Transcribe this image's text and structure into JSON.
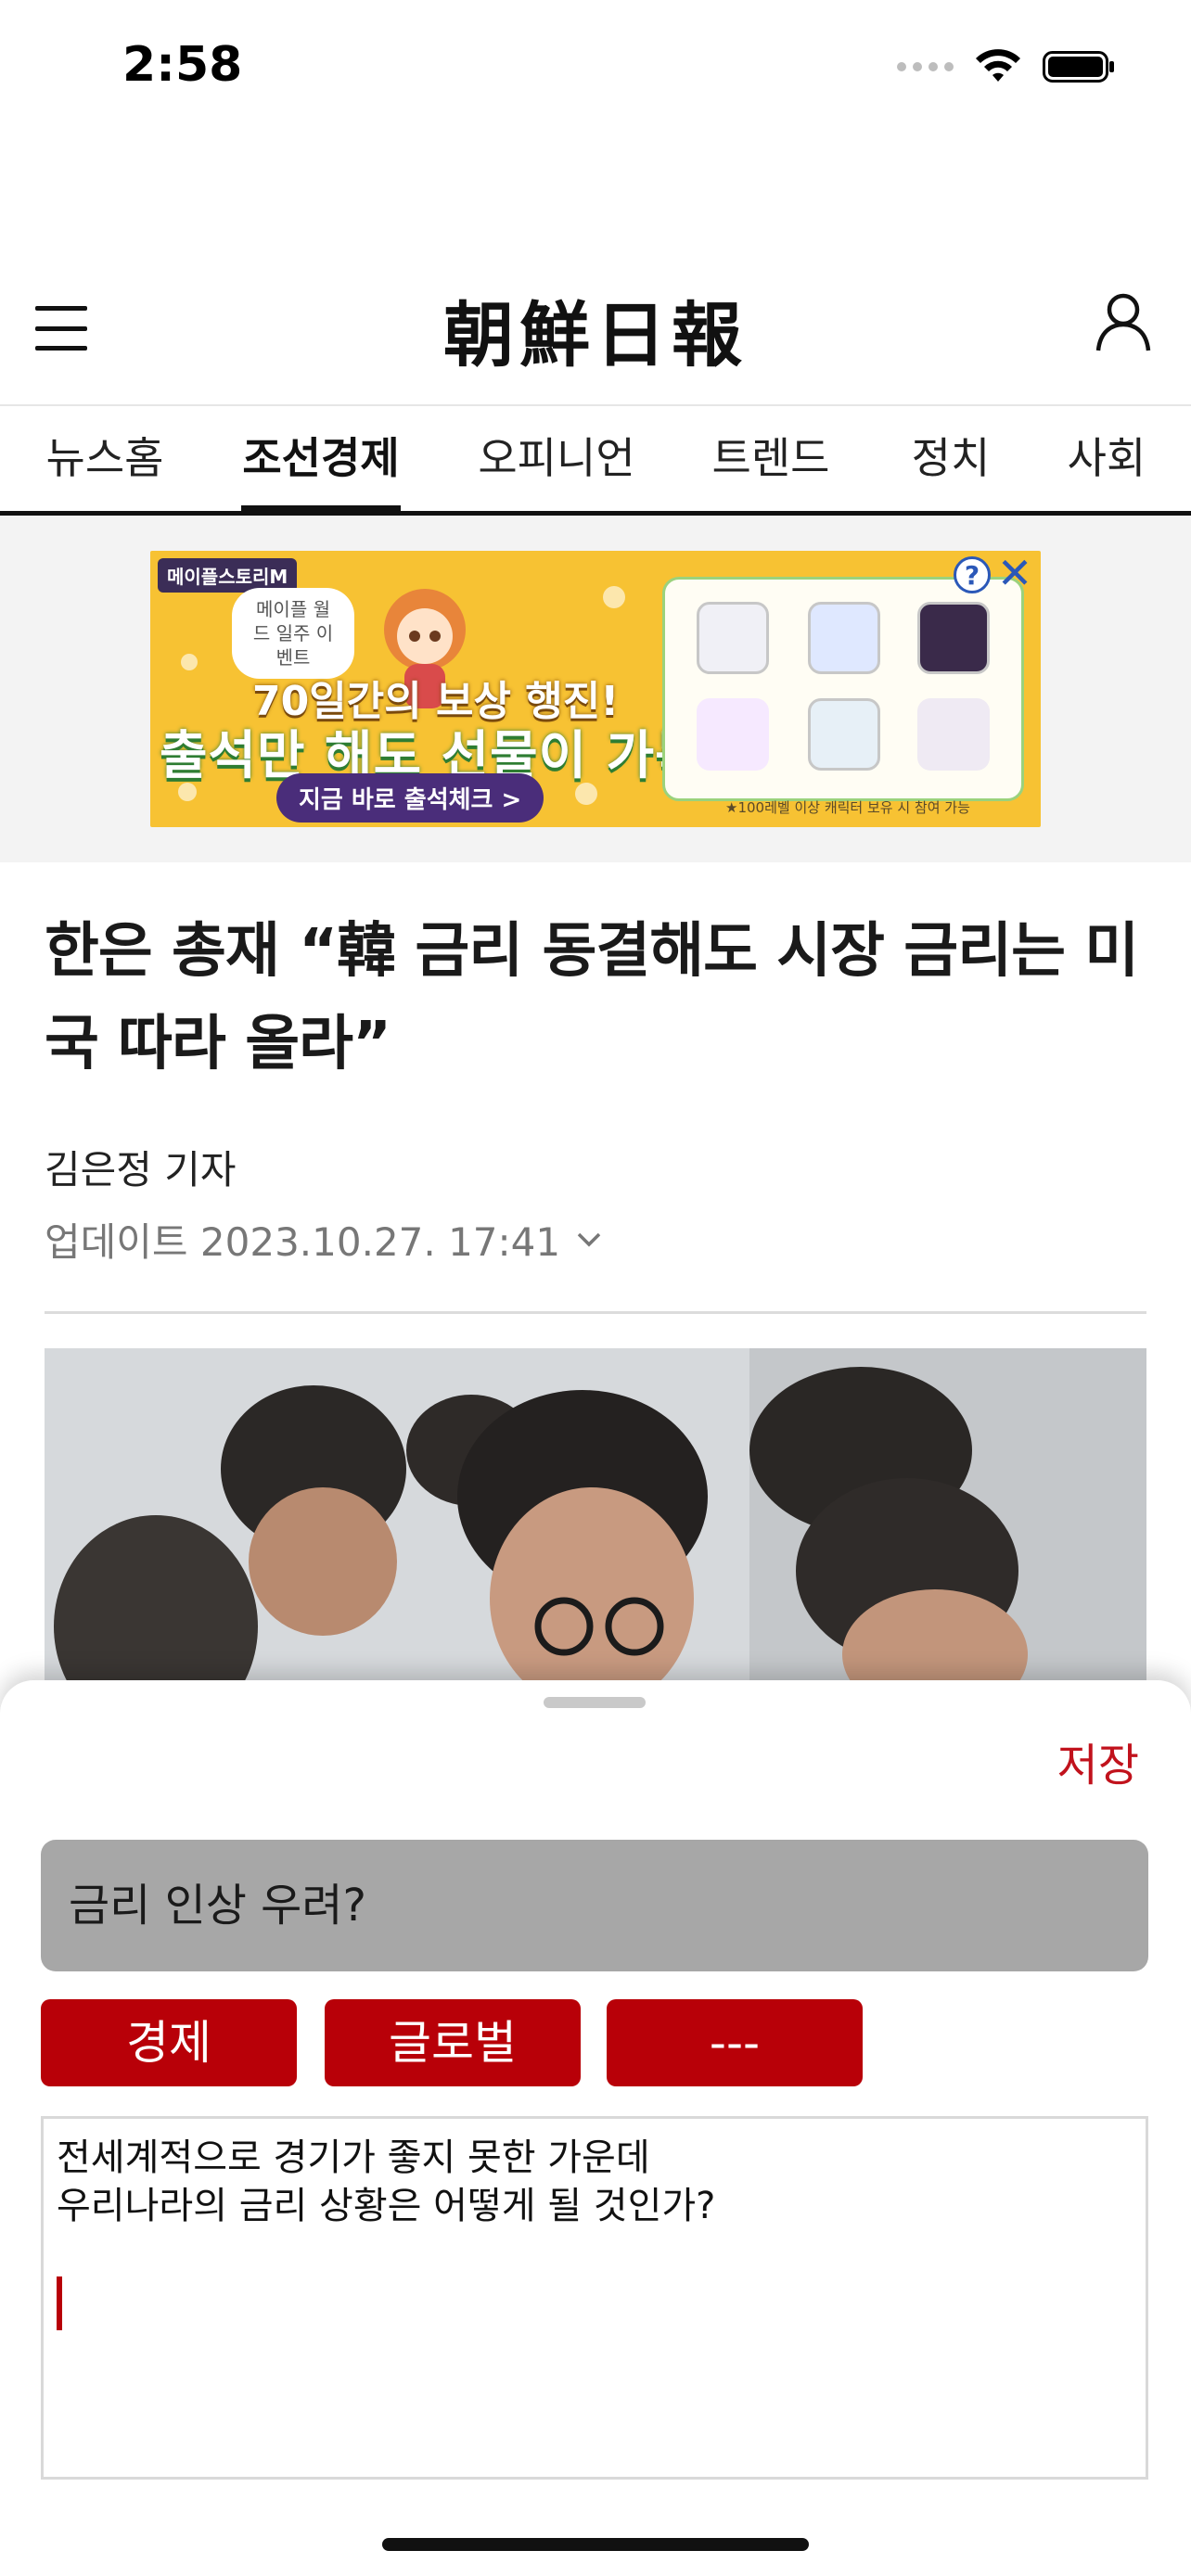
{
  "status_bar": {
    "time": "2:58"
  },
  "header": {
    "logo_text": "朝鮮日報"
  },
  "nav": {
    "tabs": [
      {
        "label": "뉴스홈",
        "active": false
      },
      {
        "label": "조선경제",
        "active": true
      },
      {
        "label": "오피니언",
        "active": false
      },
      {
        "label": "트렌드",
        "active": false
      },
      {
        "label": "정치",
        "active": false
      },
      {
        "label": "사회",
        "active": false
      }
    ]
  },
  "ad": {
    "game_tag": "메이플스토리M",
    "event_bubble": "메이플 월드 일주 이벤트",
    "headline_1": "70일간의 보상 행진!",
    "headline_2": "출석만 해도 선물이 가득",
    "cta": "지금 바로 출석체크 >",
    "footnote": "★100레벨 이상 캐릭터 보유 시 참여 가능",
    "help_label": "?",
    "close_label": "✕"
  },
  "article": {
    "headline": "한은 총재 “韓 금리 동결해도 시장 금리는 미국 따라 올라”",
    "reporter": "김은정 기자",
    "updated": "업데이트 2023.10.27. 17:41"
  },
  "sheet": {
    "save_label": "저장",
    "question": "금리 인상 우려?",
    "tags": [
      "경제",
      "글로벌",
      "---"
    ],
    "memo_lines": [
      "전세계적으로 경기가 좋지 못한 가운데",
      "우리나라의 금리 상황은 어떻게 될 것인가?"
    ]
  },
  "colors": {
    "accent": "#b80008",
    "save_text": "#c1121c",
    "question_bg": "#a7a7a7"
  }
}
